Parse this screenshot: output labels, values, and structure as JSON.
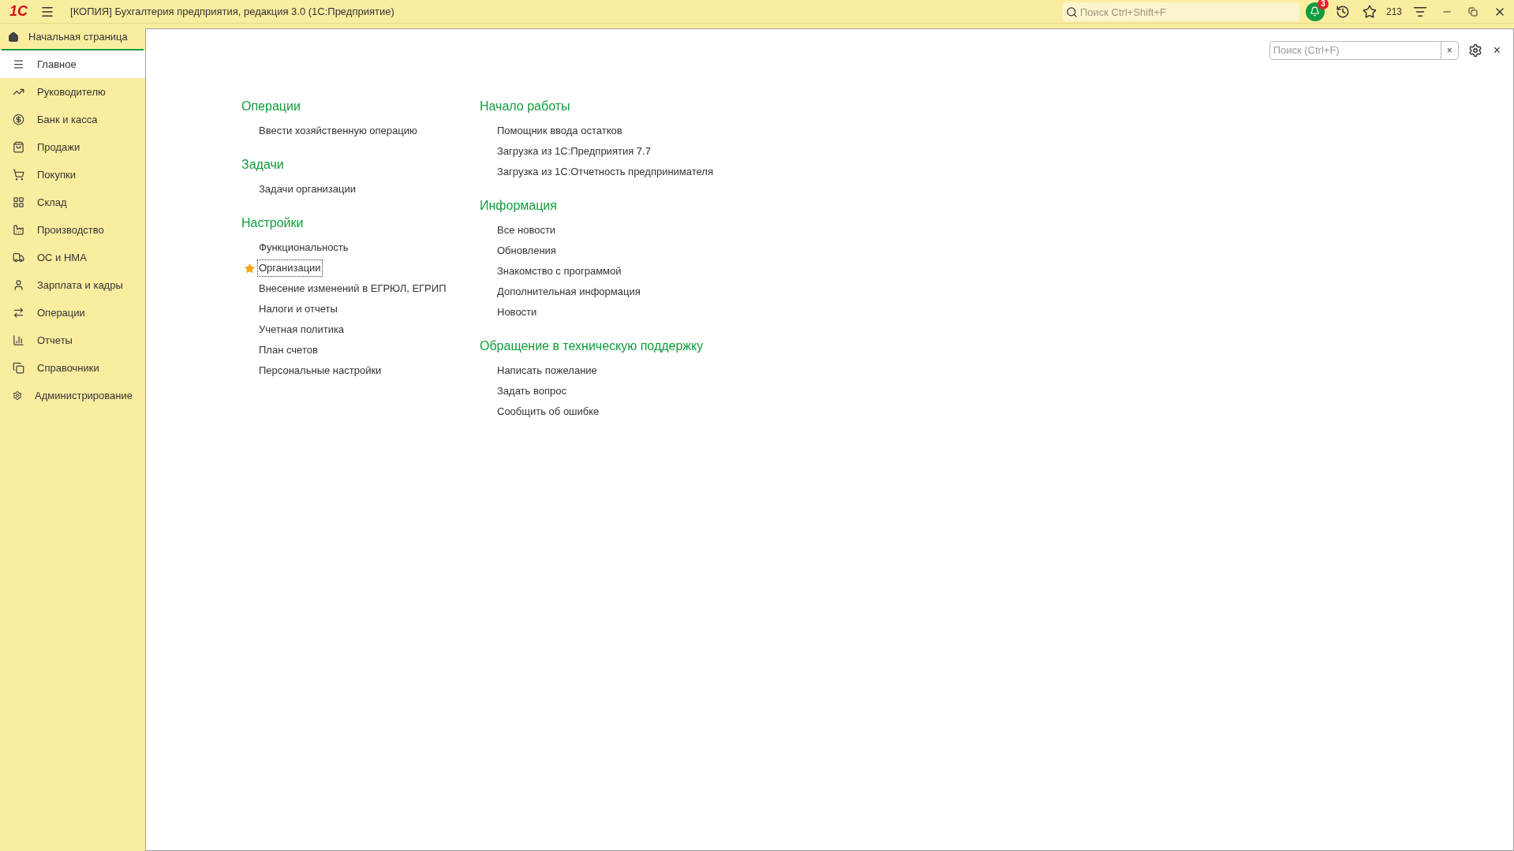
{
  "window": {
    "title": "[КОПИЯ] Бухгалтерия предприятия, редакция 3.0  (1С:Предприятие)",
    "logo": "1С",
    "search": {
      "placeholder": "Поиск Ctrl+Shift+F"
    },
    "notifications": "3",
    "favorites_count": "213"
  },
  "home_tab": {
    "label": "Начальная страница",
    "selected": true
  },
  "sidebar": {
    "items": [
      {
        "label": "Главное",
        "selected": true
      },
      {
        "label": "Руководителю",
        "selected": false
      },
      {
        "label": "Банк и касса",
        "selected": false
      },
      {
        "label": "Продажи",
        "selected": false
      },
      {
        "label": "Покупки",
        "selected": false
      },
      {
        "label": "Склад",
        "selected": false
      },
      {
        "label": "Производство",
        "selected": false
      },
      {
        "label": "ОС и НМА",
        "selected": false
      },
      {
        "label": "Зарплата и кадры",
        "selected": false
      },
      {
        "label": "Операции",
        "selected": false
      },
      {
        "label": "Отчеты",
        "selected": false
      },
      {
        "label": "Справочники",
        "selected": false
      },
      {
        "label": "Администрирование",
        "selected": false
      }
    ]
  },
  "content": {
    "search": {
      "placeholder": "Поиск (Ctrl+F)"
    },
    "clear": "×",
    "close": "×",
    "columns": [
      [
        {
          "title": "Операции",
          "items": [
            {
              "label": "Ввести хозяйственную операцию",
              "favorite": false,
              "focused": false
            }
          ]
        },
        {
          "title": "Задачи",
          "items": [
            {
              "label": "Задачи организации",
              "favorite": false,
              "focused": false
            }
          ]
        },
        {
          "title": "Настройки",
          "items": [
            {
              "label": "Функциональность",
              "favorite": false,
              "focused": false
            },
            {
              "label": "Организации",
              "favorite": true,
              "focused": true
            },
            {
              "label": "Внесение изменений в ЕГРЮЛ, ЕГРИП",
              "favorite": false,
              "focused": false
            },
            {
              "label": "Налоги и отчеты",
              "favorite": false,
              "focused": false
            },
            {
              "label": "Учетная политика",
              "favorite": false,
              "focused": false
            },
            {
              "label": "План счетов",
              "favorite": false,
              "focused": false
            },
            {
              "label": "Персональные настройки",
              "favorite": false,
              "focused": false
            }
          ]
        }
      ],
      [
        {
          "title": "Начало работы",
          "items": [
            {
              "label": "Помощник ввода остатков",
              "favorite": false,
              "focused": false
            },
            {
              "label": "Загрузка из 1С:Предприятия 7.7",
              "favorite": false,
              "focused": false
            },
            {
              "label": "Загрузка из 1С:Отчетность предпринимателя",
              "favorite": false,
              "focused": false
            }
          ]
        },
        {
          "title": "Информация",
          "items": [
            {
              "label": "Все новости",
              "favorite": false,
              "focused": false
            },
            {
              "label": "Обновления",
              "favorite": false,
              "focused": false
            },
            {
              "label": "Знакомство с программой",
              "favorite": false,
              "focused": false
            },
            {
              "label": "Дополнительная информация",
              "favorite": false,
              "focused": false
            },
            {
              "label": "Новости",
              "favorite": false,
              "focused": false
            }
          ]
        },
        {
          "title": "Обращение в техническую поддержку",
          "items": [
            {
              "label": "Написать пожелание",
              "favorite": false,
              "focused": false
            },
            {
              "label": "Задать вопрос",
              "favorite": false,
              "focused": false
            },
            {
              "label": "Сообщить об ошибке",
              "favorite": false,
              "focused": false
            }
          ]
        }
      ]
    ]
  }
}
